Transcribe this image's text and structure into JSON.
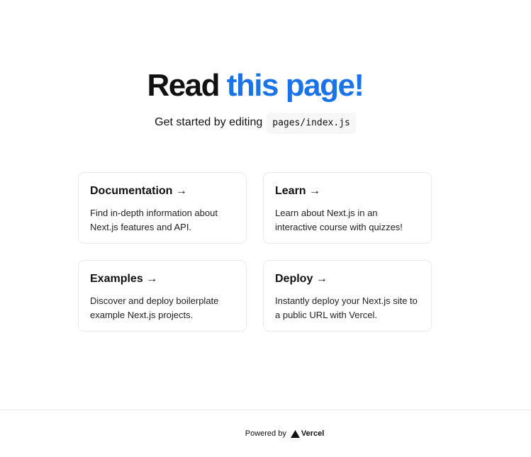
{
  "main": {
    "title_prefix": "Read ",
    "title_link": "this page!",
    "description": "Get started by editing",
    "code": "pages/index.js"
  },
  "cards": [
    {
      "title": "Documentation →",
      "text": "Find in-depth information about Next.js features and API."
    },
    {
      "title": "Learn →",
      "text": "Learn about Next.js in an interactive course with quizzes!"
    },
    {
      "title": "Examples →",
      "text": "Discover and deploy boilerplate example Next.js projects."
    },
    {
      "title": "Deploy →",
      "text": "Instantly deploy your Next.js site to a public URL with Vercel."
    }
  ],
  "footer": {
    "powered_by": "Powered by",
    "brand": "Vercel",
    "brand_icon": "vercel-triangle-icon"
  },
  "colors": {
    "accent": "#1a73e8",
    "text": "#111111",
    "border": "#eaeaea",
    "code_bg": "#f7f7f7"
  }
}
